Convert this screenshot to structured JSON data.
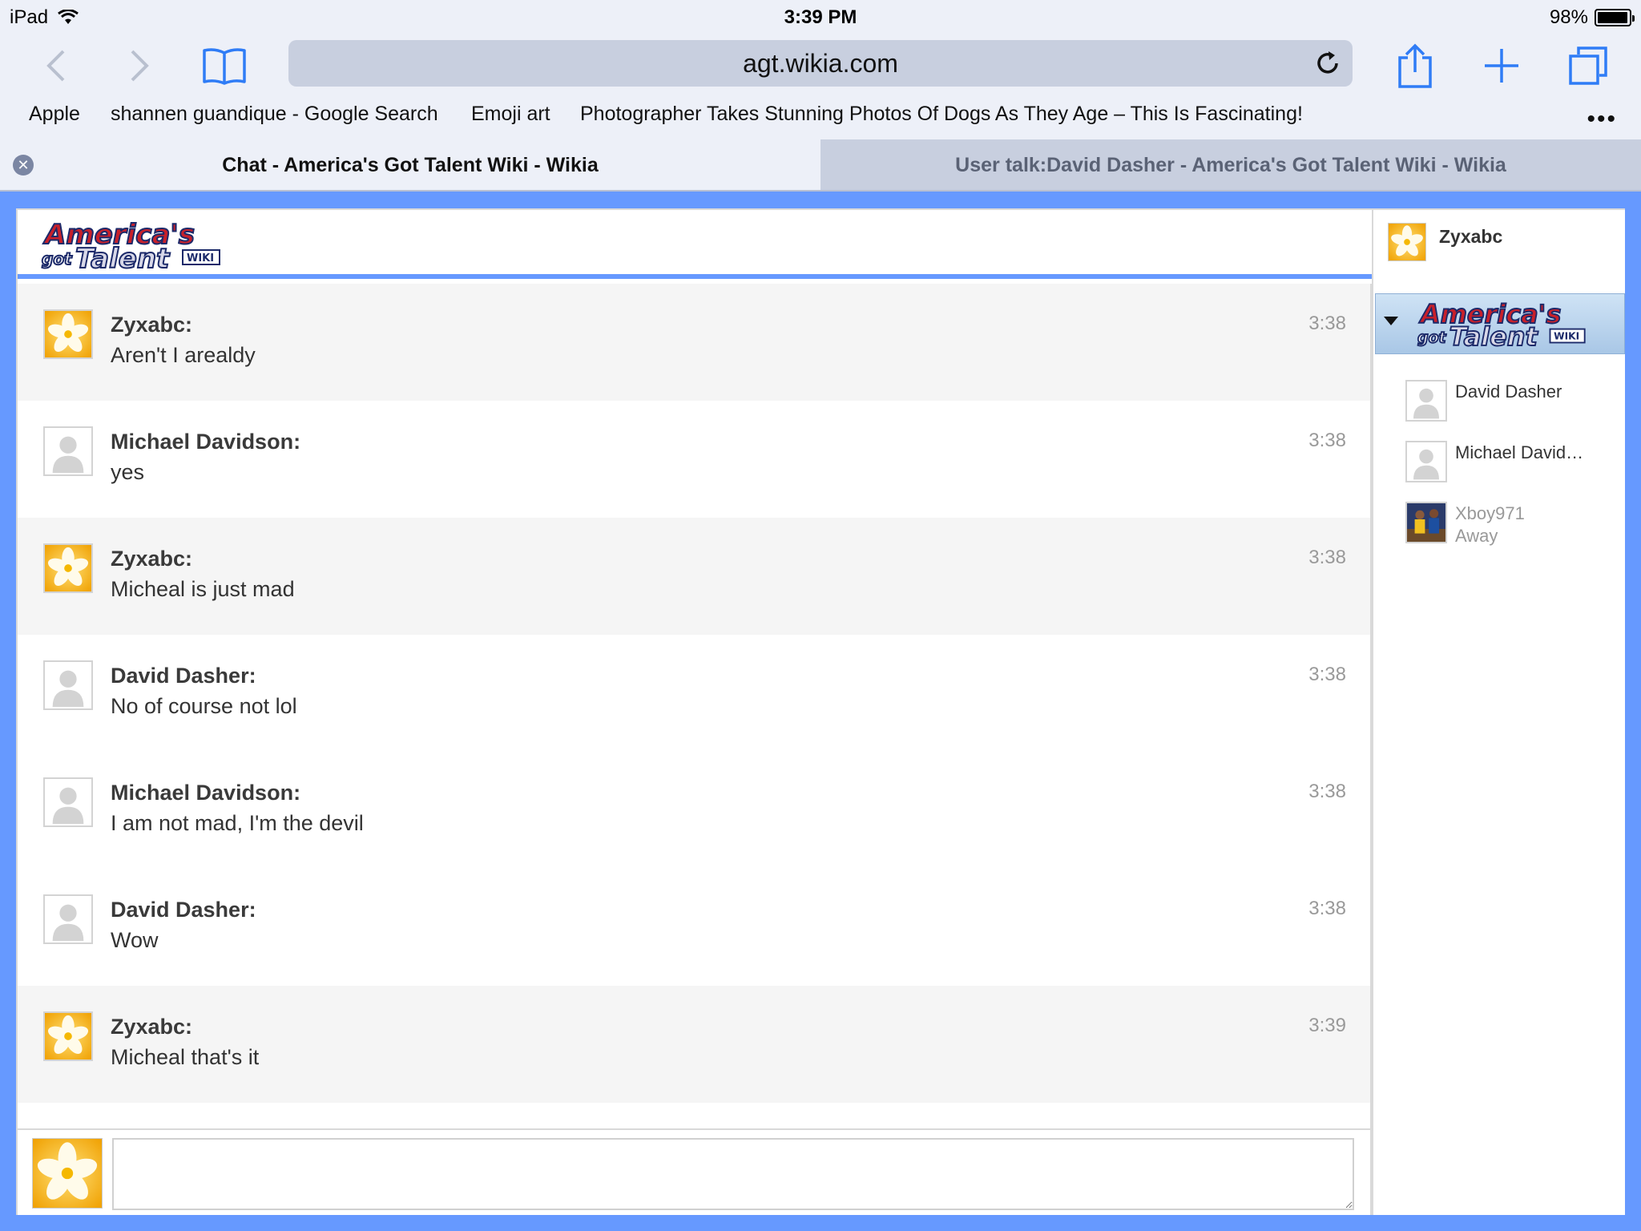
{
  "status_bar": {
    "device": "iPad",
    "time": "3:39 PM",
    "battery": "98%",
    "battery_level": 0.98
  },
  "browser": {
    "url": "agt.wikia.com",
    "bookmarks": [
      "Apple",
      "shannen guandique - Google Search",
      "Emoji art",
      "Photographer Takes Stunning Photos Of Dogs As They Age – This Is Fascinating!"
    ],
    "more": "•••",
    "tabs": [
      {
        "title": "Chat - America's Got Talent Wiki - Wikia",
        "active": true
      },
      {
        "title": "User talk:David Dasher - America's Got Talent Wiki - Wikia",
        "active": false
      }
    ],
    "tab_close": "✕"
  },
  "wiki": {
    "logo_line1": "America's",
    "logo_line2": "got Talent",
    "logo_tag": "WIKI"
  },
  "self_user": {
    "name": "Zyxabc"
  },
  "messages": [
    {
      "user": "Zyxabc:",
      "text": "Aren't I arealdy",
      "time": "3:38",
      "avatar": "flower"
    },
    {
      "user": "Michael Davidson:",
      "text": "yes",
      "time": "3:38",
      "avatar": "default"
    },
    {
      "user": "Zyxabc:",
      "text": "Micheal is just mad",
      "time": "3:38",
      "avatar": "flower"
    },
    {
      "user": "David Dasher:",
      "text": "No of course not lol",
      "time": "3:38",
      "avatar": "default"
    },
    {
      "user": "Michael Davidson:",
      "text": "I am not mad, I'm the devil",
      "time": "3:38",
      "avatar": "default"
    },
    {
      "user": "David Dasher:",
      "text": "Wow",
      "time": "3:38",
      "avatar": "default"
    },
    {
      "user": "Zyxabc:",
      "text": "Micheal that's it",
      "time": "3:39",
      "avatar": "flower"
    }
  ],
  "userlist": [
    {
      "name": "David Dasher",
      "status": "",
      "avatar": "default"
    },
    {
      "name": "Michael David…",
      "status": "",
      "avatar": "default"
    },
    {
      "name": "Xboy971",
      "status": "Away",
      "avatar": "photo"
    }
  ],
  "input": {
    "value": "",
    "placeholder": ""
  },
  "colors": {
    "page_bg": "#6699ff",
    "chrome_bg": "#edf0f8",
    "url_bar": "#c8cfdf",
    "ios_blue": "#2f7cf6",
    "message_alt": "#f5f5f5",
    "timestamp": "#999999"
  }
}
